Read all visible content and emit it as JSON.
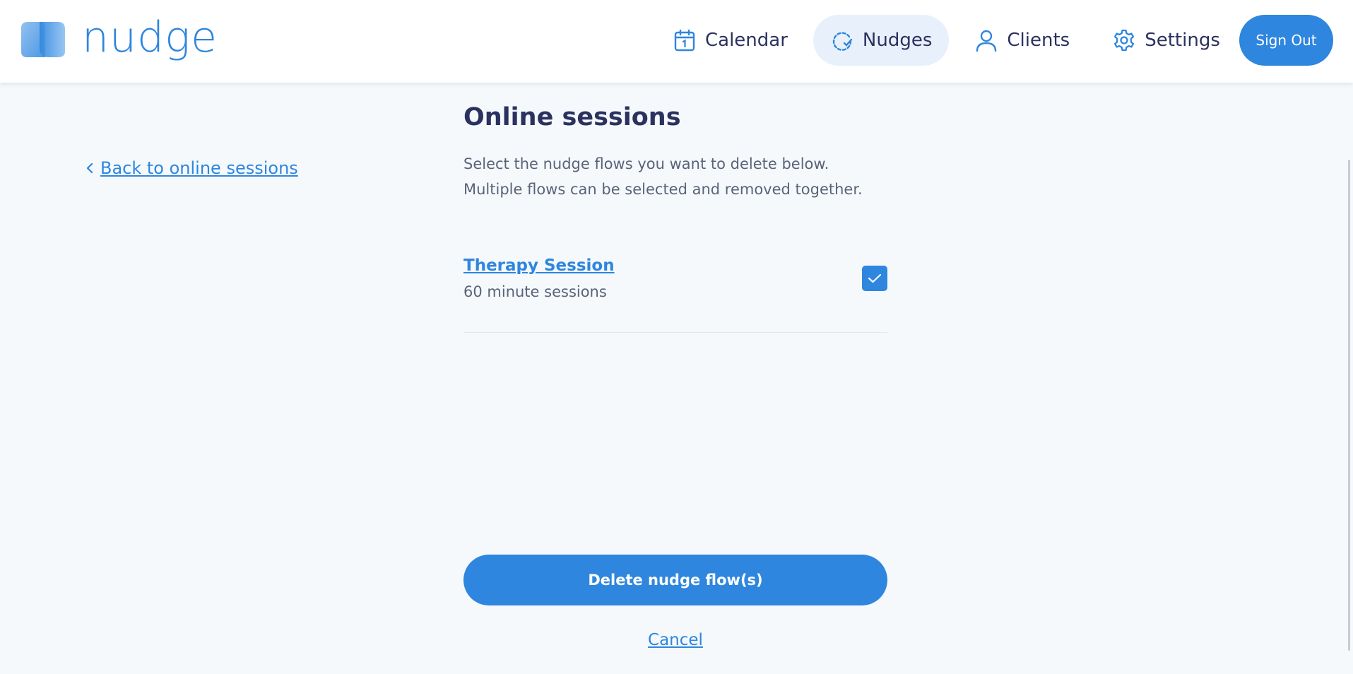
{
  "header": {
    "logo_text": "nudge",
    "nav": [
      {
        "label": "Calendar",
        "icon": "calendar-icon",
        "active": false
      },
      {
        "label": "Nudges",
        "icon": "nudges-icon",
        "active": true
      },
      {
        "label": "Clients",
        "icon": "user-icon",
        "active": false
      },
      {
        "label": "Settings",
        "icon": "gear-icon",
        "active": false
      }
    ],
    "sign_out_label": "Sign Out"
  },
  "back_link": {
    "icon": "chevron-left-icon",
    "label": "Back to online sessions"
  },
  "main": {
    "title": "Online sessions",
    "description_line1": "Select the nudge flows you want to delete below.",
    "description_line2": "Multiple flows can be selected and removed together.",
    "flows": [
      {
        "title": "Therapy Session",
        "subtitle": "60 minute sessions",
        "checked": true
      }
    ],
    "delete_label": "Delete nudge flow(s)",
    "cancel_label": "Cancel"
  },
  "colors": {
    "accent": "#2e86de",
    "text_dark": "#2b3260",
    "text_muted": "#5b6378",
    "background": "#f5f9fc",
    "active_nav_bg": "#e8f1fb"
  }
}
